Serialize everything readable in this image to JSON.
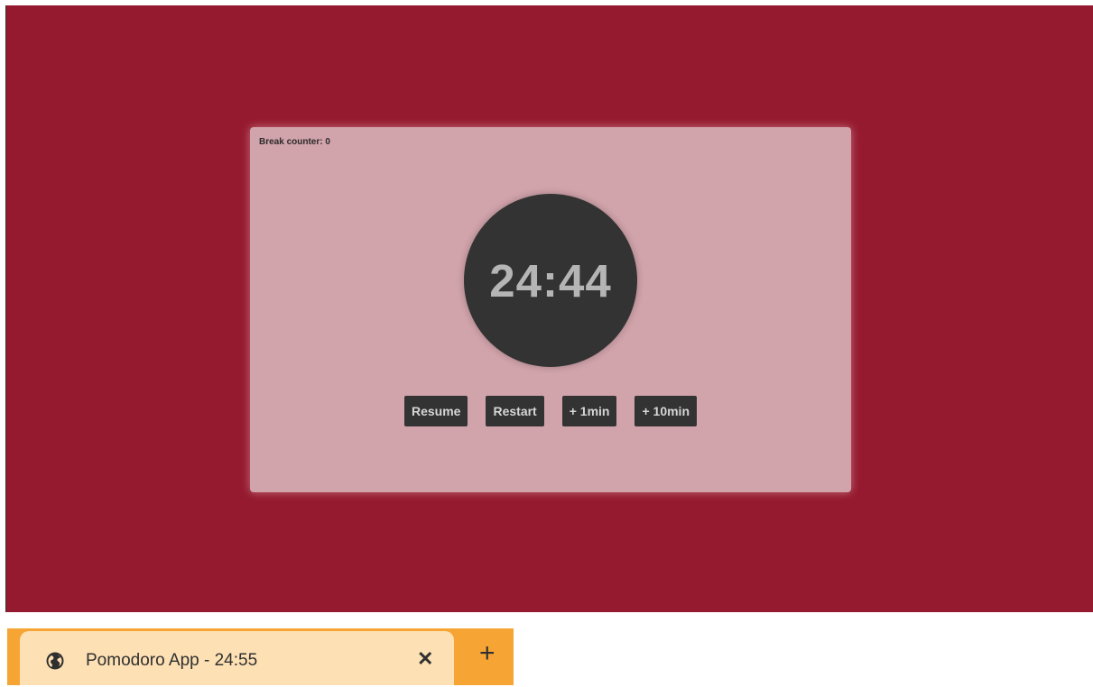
{
  "app": {
    "break_counter": "Break counter: 0",
    "timer": "24:44",
    "buttons": {
      "resume": "Resume",
      "restart": "Restart",
      "add_1min": "+ 1min",
      "add_10min": "+ 10min"
    }
  },
  "browser_tab": {
    "title": "Pomodoro App - 24:55",
    "favicon": "globe-icon",
    "close_symbol": "✕",
    "new_tab_symbol": "+"
  },
  "colors": {
    "background": "#951a2f",
    "card": "#d1a3ab",
    "timer_circle": "#333333",
    "tab_bar": "#f6a534",
    "active_tab": "#fde0b3"
  }
}
